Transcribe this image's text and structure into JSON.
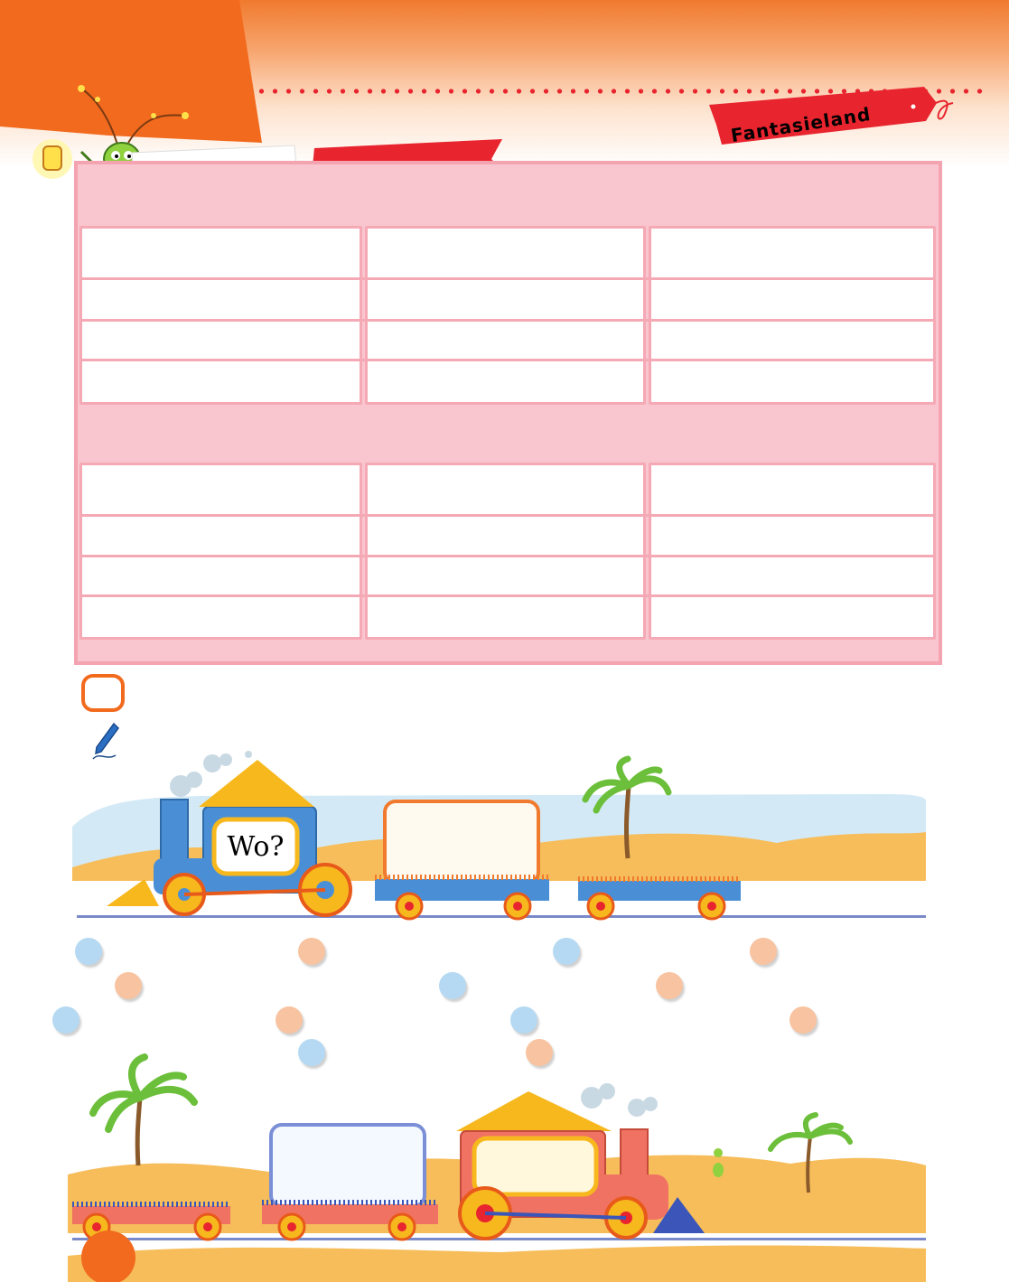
{
  "banner": {
    "text": "Fantasieland"
  },
  "train_top": {
    "sign": "Wo?"
  },
  "colors": {
    "orange": "#f26a1e",
    "red_banner": "#e8242e",
    "table_pink": "#f9c6cf",
    "dot_blue": "#b5d9f2",
    "dot_peach": "#f8c3a0"
  },
  "icons": [
    "firefly-mascot",
    "pencil-icon",
    "palm-tree",
    "train"
  ]
}
